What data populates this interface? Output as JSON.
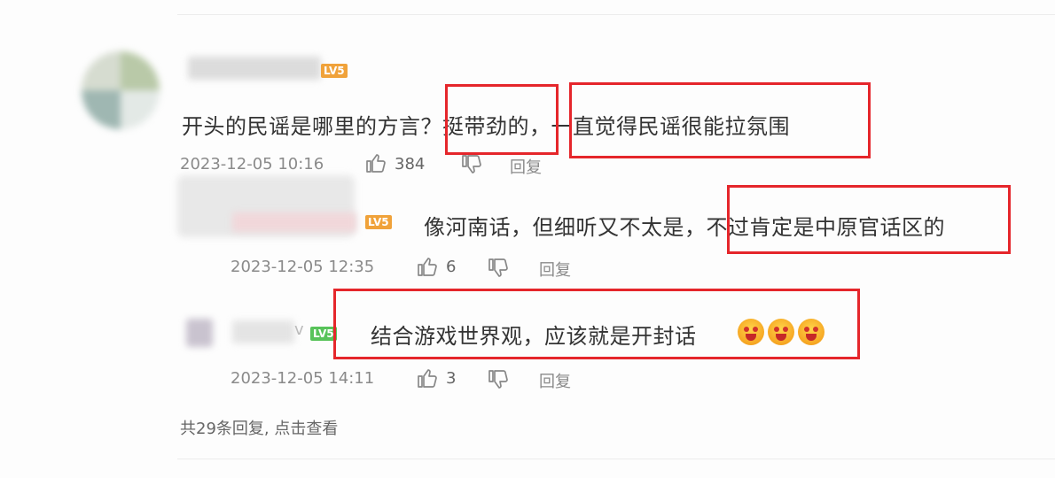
{
  "comment": {
    "text": "开头的民谣是哪里的方言？挺带劲的，一直觉得民谣很能拉氛围",
    "level_badge": "LV5",
    "timestamp": "2023-12-05 10:16",
    "likes": "384",
    "reply_label": "回复"
  },
  "replies": [
    {
      "level_badge": "LV5",
      "text": "像河南话，但细听又不太是，不过肯定是中原官话区的",
      "timestamp": "2023-12-05 12:35",
      "likes": "6",
      "reply_label": "回复"
    },
    {
      "level_badge": "LV5",
      "text": "结合游戏世界观，应该就是开封话",
      "emoji": [
        "flushed-emoji",
        "flushed-emoji",
        "flushed-emoji"
      ],
      "timestamp": "2023-12-05 14:11",
      "likes": "3",
      "reply_label": "回复"
    }
  ],
  "reply_summary": "共29条回复, 点击查看",
  "colors": {
    "highlight": "#e5262b",
    "meta_text": "#8a8a8a",
    "badge_orange": "#f0a23a",
    "badge_green": "#58c35a"
  }
}
